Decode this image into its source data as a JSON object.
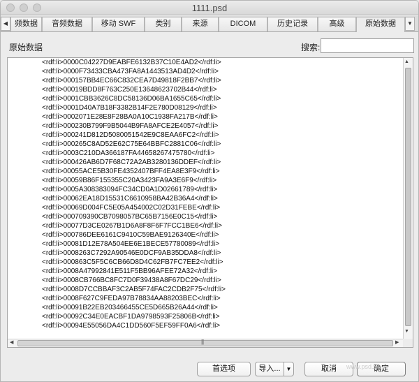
{
  "window": {
    "title": "1111.psd"
  },
  "tabs": [
    {
      "label": "频数据"
    },
    {
      "label": "音频数据"
    },
    {
      "label": "移动 SWF"
    },
    {
      "label": "类别"
    },
    {
      "label": "来源"
    },
    {
      "label": "DICOM"
    },
    {
      "label": "历史记录"
    },
    {
      "label": "高级"
    },
    {
      "label": "原始数据"
    }
  ],
  "tab_arrows": {
    "left": "◀",
    "right": "▼"
  },
  "section": {
    "title": "原始数据",
    "search_label": "搜索:",
    "search_value": ""
  },
  "raw_lines": [
    "<rdf:li>0000C04227D9EABFE6132B37C10E4AD2</rdf:li>",
    "<rdf:li>0000F73433CBA473FA8A1443513AD4D2</rdf:li>",
    "<rdf:li>000157BB4EC66C832CEA7D49818F2BB7</rdf:li>",
    "<rdf:li>00019BDD8F763C250E13648623702B44</rdf:li>",
    "<rdf:li>0001CBB3626C8DC58136D06BA1655C65</rdf:li>",
    "<rdf:li>0001D40A7B18F3382B14F2E780D08129</rdf:li>",
    "<rdf:li>0002071E28E8F28BA0A10C1938FA217B</rdf:li>",
    "<rdf:li>000230B799F9B5044B9FA8AFCE2E4057</rdf:li>",
    "<rdf:li>000241D812D5080051542E9C8EAA6FC2</rdf:li>",
    "<rdf:li>000265C8AD52E62C75E64BBFC2881C06</rdf:li>",
    "<rdf:li>0003C210DA366187FA44658267475780</rdf:li>",
    "<rdf:li>000426AB6D7F68C72A2AB3280136DDEF</rdf:li>",
    "<rdf:li>00055ACE5B30FE4352407BFF4EA8E3F9</rdf:li>",
    "<rdf:li>00059B86F155355C20A3423FA9A3E6F9</rdf:li>",
    "<rdf:li>0005A308383094FC34CD0A1D02661789</rdf:li>",
    "<rdf:li>00062EA18D15531C6610958BA42B36A4</rdf:li>",
    "<rdf:li>00069D004FC5E05A454002C02D31FEBE</rdf:li>",
    "<rdf:li>000709390CB7098057BC65B7156E0C15</rdf:li>",
    "<rdf:li>00077D3CE0267B1D6A8F8F6F7FCC1BE6</rdf:li>",
    "<rdf:li>000786DEE6161C9410C59BAE9126340E</rdf:li>",
    "<rdf:li>00081D12E78A504EE6E1BECE57780089</rdf:li>",
    "<rdf:li>0008263C7292A90546E0DCF9AB35DDA8</rdf:li>",
    "<rdf:li>000863C5F5C6CB66D8D4C62FB7FC7EE2</rdf:li>",
    "<rdf:li>0008A47992841E511F5BB96AFEE72A32</rdf:li>",
    "<rdf:li>0008CB766BC8FC7D0F39438A8F67DC29</rdf:li>",
    "<rdf:li>0008D7CCBBAF3C2AB5F74FAC2CDB2F75</rdf:li>",
    "<rdf:li>0008F627C9FEDA97B78834AA88203BEC</rdf:li>",
    "<rdf:li>00091B22EB203466455CE5D665B26A44</rdf:li>",
    "<rdf:li>00092C34E0EACBF1DA9798593F25806B</rdf:li>",
    "<rdf:li>00094E55056DA4C1DD560F5EF59FF0A6</rdf:li>"
  ],
  "buttons": {
    "preferences": "首选项",
    "import": "导入...",
    "import_dropdown": "▼",
    "cancel": "取消",
    "ok": "确定"
  },
  "watermark": "www.psd.vip"
}
